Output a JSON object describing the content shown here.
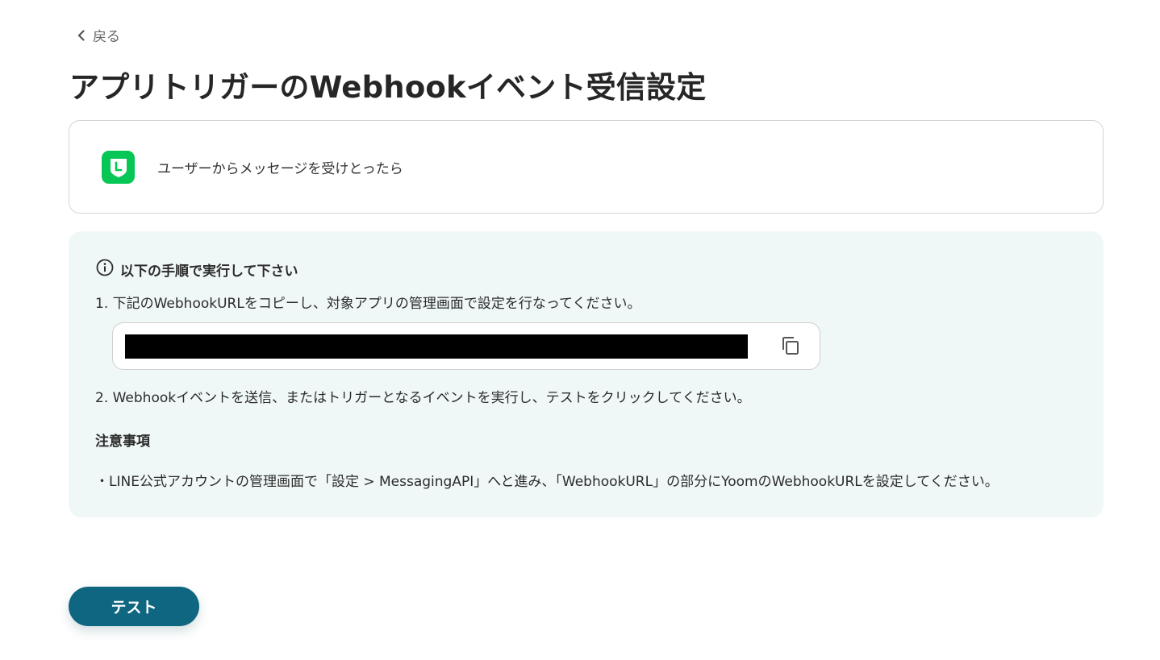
{
  "nav": {
    "back_label": "戻る",
    "back_icon": "chevron-left-icon"
  },
  "page": {
    "title": "アプリトリガーのWebhookイベント受信設定"
  },
  "trigger": {
    "app_icon": "line-app-icon",
    "app_color": "#06c755",
    "label": "ユーザーからメッセージを受けとったら"
  },
  "instructions": {
    "info_icon": "info-icon",
    "heading": "以下の手順で実行して下さい",
    "step1": "1. 下記のWebhookURLをコピーし、対象アプリの管理画面で設定を行なってください。",
    "webhook_url": "",
    "copy_icon": "copy-icon",
    "step2": "2. Webhookイベントを送信、またはトリガーとなるイベントを実行し、テストをクリックしてください。",
    "notes_title": "注意事項",
    "note1": "・LINE公式アカウントの管理画面で「設定 > MessagingAPI」へと進み、「WebhookURL」の部分にYoomのWebhookURLを設定してください。",
    "box_color": "#f0f8f7"
  },
  "actions": {
    "test_label": "テスト",
    "test_color": "#0f6680"
  }
}
